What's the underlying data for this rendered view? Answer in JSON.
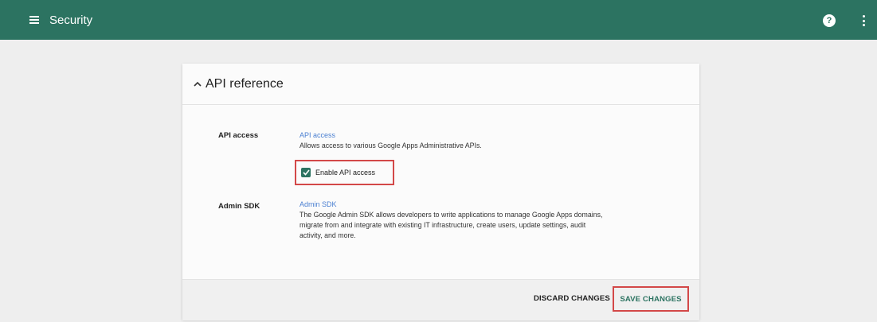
{
  "topbar": {
    "title": "Security",
    "menu_icon": "menu-icon",
    "help_icon": "help-icon",
    "help_glyph": "?",
    "more_icon": "more-vert-icon"
  },
  "card": {
    "title": "API reference",
    "collapse_icon": "chevron-up-icon",
    "api_access": {
      "label": "API access",
      "link": "API access",
      "description": "Allows access to various Google Apps Administrative APIs.",
      "checkbox_label": "Enable API access",
      "checked": true
    },
    "admin_sdk": {
      "label": "Admin SDK",
      "link": "Admin SDK",
      "description_lines": [
        "The Google Admin SDK allows developers to write applications to manage Google Apps domains,",
        "migrate from and integrate with existing IT infrastructure, create users, update settings, audit",
        "activity, and more."
      ]
    },
    "footer": {
      "discard_label": "DISCARD CHANGES",
      "save_label": "SAVE CHANGES"
    }
  },
  "colors": {
    "topbar": "#2c7361",
    "accent": "#2c7361",
    "highlight_border": "#d34848",
    "link": "#4a7fd1",
    "background": "#eeeeee"
  }
}
